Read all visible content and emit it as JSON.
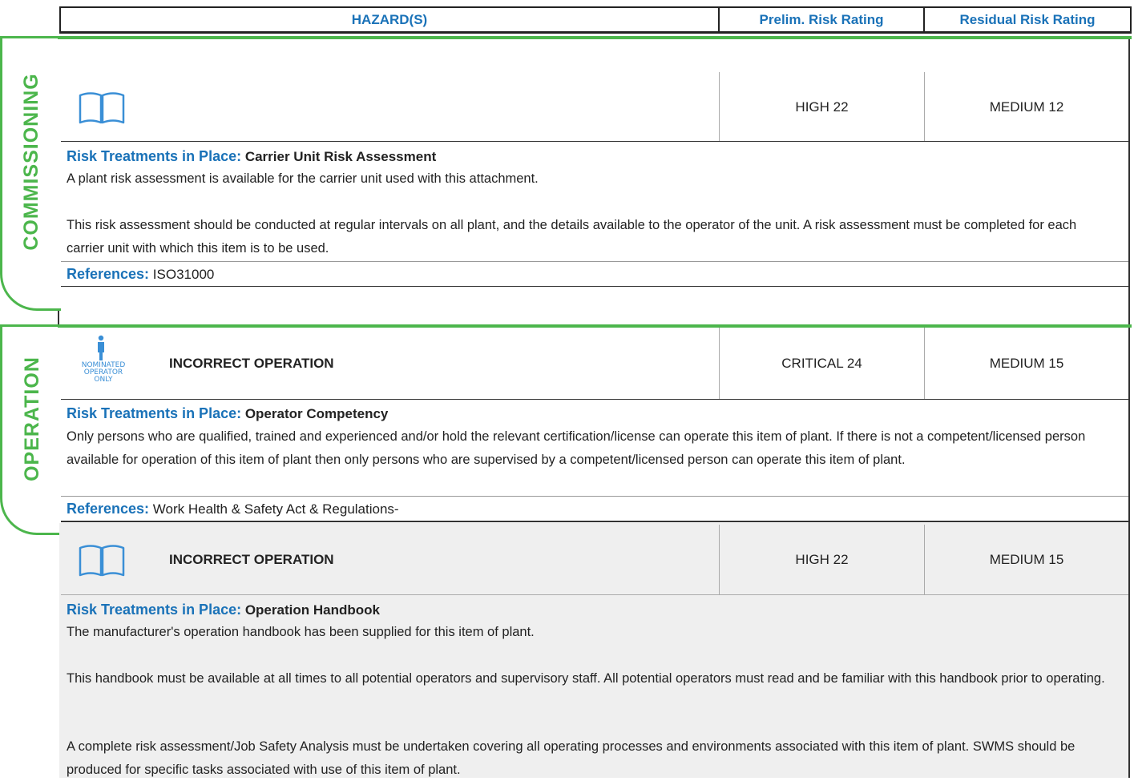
{
  "header": {
    "hazards": "HAZARD(S)",
    "prelim": "Prelim. Risk Rating",
    "residual": "Residual Risk Rating"
  },
  "sections": {
    "commissioning": "COMMISSIONING",
    "operation": "OPERATION"
  },
  "rows": [
    {
      "icon": "handbook-icon",
      "hazard": "",
      "prelim": "HIGH 22",
      "residual": "MEDIUM 12",
      "treatment_label": "Risk Treatments in Place:",
      "treatment_title": "Carrier Unit Risk Assessment",
      "paragraphs": [
        "A plant risk assessment is available for the carrier unit used with this attachment.",
        "This risk assessment should be conducted at regular intervals on all plant, and the details available to the operator of the unit. A risk assessment must be completed for each carrier unit with which this item is to be used."
      ],
      "references_label": "References:",
      "references": "ISO31000"
    },
    {
      "icon": "nominated-operator-icon",
      "icon_text": [
        "NOMINATED",
        "OPERATOR",
        "ONLY"
      ],
      "hazard": "INCORRECT OPERATION",
      "prelim": "CRITICAL 24",
      "residual": "MEDIUM 15",
      "treatment_label": "Risk Treatments in Place:",
      "treatment_title": "Operator Competency",
      "paragraphs": [
        "Only persons who are qualified, trained and experienced and/or hold the relevant certification/license can operate this item of plant. If there is not a competent/licensed person available for operation of this item of plant then only persons who are supervised by a competent/licensed person can operate this item of plant."
      ],
      "references_label": "References:",
      "references": "Work Health & Safety Act & Regulations-"
    },
    {
      "icon": "handbook-icon",
      "hazard": "INCORRECT OPERATION",
      "prelim": "HIGH 22",
      "residual": "MEDIUM 15",
      "treatment_label": "Risk Treatments in Place:",
      "treatment_title": "Operation Handbook",
      "paragraphs": [
        "The manufacturer's operation handbook has been supplied for this item of plant.",
        "This handbook must be available at all times to all potential operators and supervisory staff. All potential operators must read and be familiar with this handbook prior to operating.",
        "A complete risk assessment/Job Safety Analysis must be undertaken covering all operating processes and environments associated with this item of plant. SWMS should be produced for specific tasks associated with use of this item of plant."
      ]
    }
  ],
  "colors": {
    "accent_blue": "#1a72b8",
    "section_green": "#4cb64c",
    "icon_blue": "#3a8fd6",
    "grey_row": "#efefef"
  }
}
